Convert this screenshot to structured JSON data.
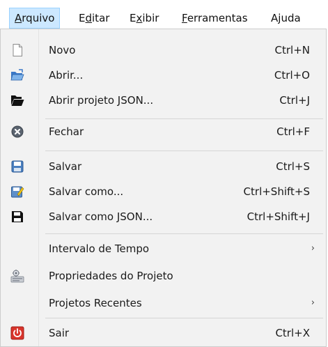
{
  "menubar": {
    "items": [
      {
        "prefix": "",
        "mnemonic": "A",
        "suffix": "rquivo",
        "active": true
      },
      {
        "prefix": "E",
        "mnemonic": "d",
        "suffix": "itar"
      },
      {
        "prefix": "E",
        "mnemonic": "x",
        "suffix": "ibir"
      },
      {
        "prefix": "",
        "mnemonic": "F",
        "suffix": "erramentas"
      },
      {
        "prefix": "A",
        "mnemonic": "j",
        "suffix": "uda"
      }
    ]
  },
  "menu": {
    "items": [
      {
        "label": "Novo",
        "shortcut": "Ctrl+N",
        "icon": "new-file-icon"
      },
      {
        "label": "Abrir...",
        "shortcut": "Ctrl+O",
        "icon": "open-folder-icon"
      },
      {
        "label": "Abrir projeto JSON...",
        "shortcut": "Ctrl+J",
        "icon": "open-json-folder-icon"
      },
      {
        "label": "Fechar",
        "shortcut": "Ctrl+F",
        "icon": "close-circle-icon"
      },
      {
        "label": "Salvar",
        "shortcut": "Ctrl+S",
        "icon": "save-disk-icon"
      },
      {
        "label": "Salvar como...",
        "shortcut": "Ctrl+Shift+S",
        "icon": "save-as-icon"
      },
      {
        "label": "Salvar como JSON...",
        "shortcut": "Ctrl+Shift+J",
        "icon": "save-json-icon"
      },
      {
        "label": "Intervalo de Tempo",
        "shortcut": "",
        "submenu_arrow": "›"
      },
      {
        "label": "Propriedades do Projeto",
        "shortcut": "",
        "icon": "project-properties-icon"
      },
      {
        "label": "Projetos Recentes",
        "shortcut": "",
        "submenu_arrow": "›"
      },
      {
        "label": "Sair",
        "shortcut": "Ctrl+X",
        "icon": "power-off-icon"
      }
    ]
  }
}
